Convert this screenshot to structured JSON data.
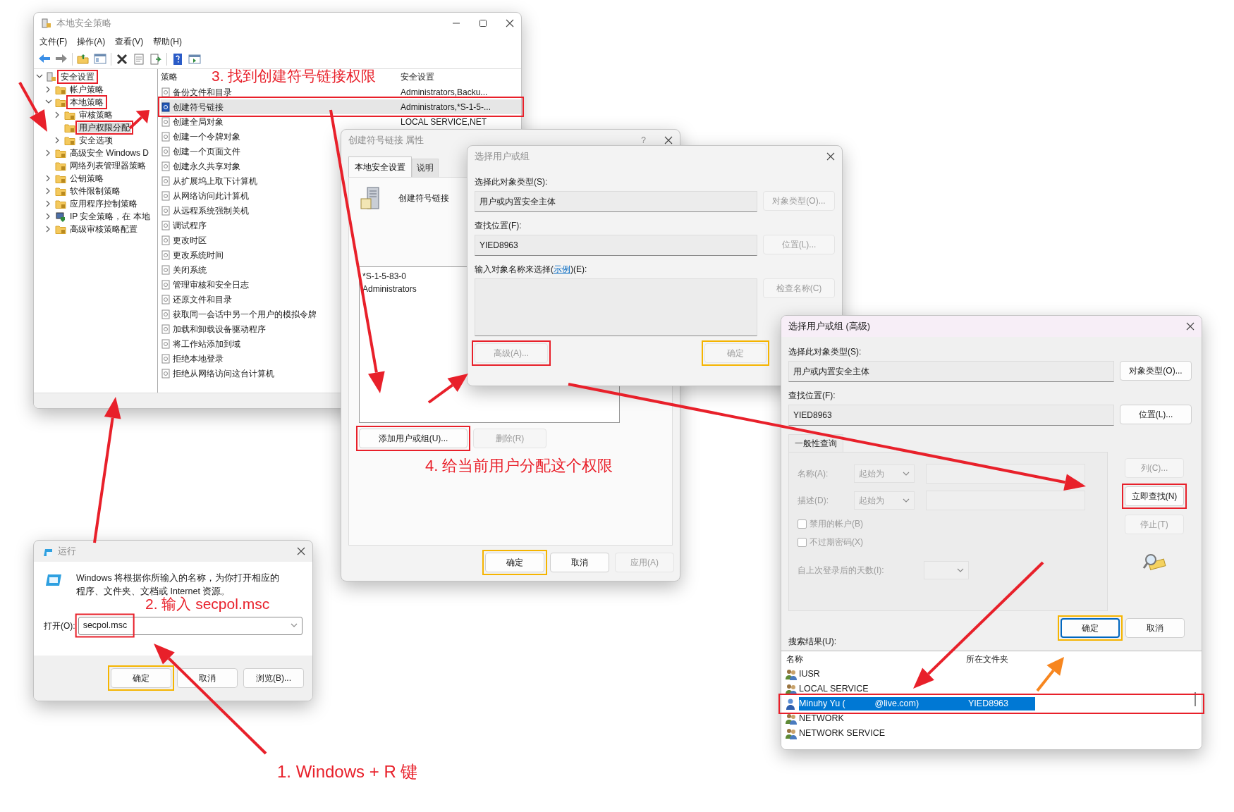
{
  "main_window": {
    "title": "本地安全策略",
    "active": false,
    "menu": [
      "文件(F)",
      "操作(A)",
      "查看(V)",
      "帮助(H)"
    ],
    "tree": [
      {
        "label": "安全设置",
        "kind": "security",
        "expandable": true,
        "expanded": true,
        "selected": false,
        "children": [
          {
            "label": "帐户策略",
            "kind": "folder",
            "expandable": true,
            "expanded": false,
            "selected": false
          },
          {
            "label": "本地策略",
            "kind": "folder",
            "expandable": true,
            "expanded": true,
            "selected": false,
            "children": [
              {
                "label": "审核策略",
                "kind": "folder",
                "expandable": true,
                "expanded": false,
                "selected": false
              },
              {
                "label": "用户权限分配",
                "kind": "folder",
                "expandable": false,
                "selected": true
              },
              {
                "label": "安全选项",
                "kind": "folder",
                "expandable": true,
                "expanded": false,
                "selected": false
              }
            ]
          },
          {
            "label": "高级安全 Windows D",
            "kind": "folder",
            "expandable": true,
            "expanded": false,
            "selected": false
          },
          {
            "label": "网络列表管理器策略",
            "kind": "folder",
            "expandable": false,
            "selected": false
          },
          {
            "label": "公钥策略",
            "kind": "folder",
            "expandable": true,
            "expanded": false,
            "selected": false
          },
          {
            "label": "软件限制策略",
            "kind": "folder",
            "expandable": true,
            "expanded": false,
            "selected": false
          },
          {
            "label": "应用程序控制策略",
            "kind": "folder",
            "expandable": true,
            "expanded": false,
            "selected": false
          },
          {
            "label": "IP 安全策略，在 本地",
            "kind": "ip",
            "expandable": true,
            "expanded": false,
            "selected": false
          },
          {
            "label": "高级审核策略配置",
            "kind": "folder",
            "expandable": true,
            "expanded": false,
            "selected": false
          }
        ]
      }
    ],
    "columns": [
      "策略",
      "安全设置"
    ],
    "rows": [
      {
        "policy": "备份文件和目录",
        "setting": "Administrators,Backu...",
        "selected": false
      },
      {
        "policy": "创建符号链接",
        "setting": "Administrators,*S-1-5-...",
        "selected": true
      },
      {
        "policy": "创建全局对象",
        "setting": "LOCAL SERVICE,NET",
        "selected": false
      },
      {
        "policy": "创建一个令牌对象",
        "selected": false
      },
      {
        "policy": "创建一个页面文件",
        "selected": false
      },
      {
        "policy": "创建永久共享对象",
        "selected": false
      },
      {
        "policy": "从扩展坞上取下计算机",
        "selected": false
      },
      {
        "policy": "从网络访问此计算机",
        "selected": false
      },
      {
        "policy": "从远程系统强制关机",
        "selected": false
      },
      {
        "policy": "调试程序",
        "selected": false
      },
      {
        "policy": "更改时区",
        "selected": false
      },
      {
        "policy": "更改系统时间",
        "selected": false
      },
      {
        "policy": "关闭系统",
        "selected": false
      },
      {
        "policy": "管理审核和安全日志",
        "selected": false
      },
      {
        "policy": "还原文件和目录",
        "selected": false
      },
      {
        "policy": "获取同一会话中另一个用户的模拟令牌",
        "selected": false
      },
      {
        "policy": "加载和卸载设备驱动程序",
        "selected": false
      },
      {
        "policy": "将工作站添加到域",
        "selected": false
      },
      {
        "policy": "拒绝本地登录",
        "selected": false
      },
      {
        "policy": "拒绝从网络访问这台计算机",
        "selected": false
      }
    ]
  },
  "properties_dialog": {
    "title": "创建符号链接 属性",
    "active": false,
    "help": "?",
    "tabs": [
      {
        "label": "本地安全设置",
        "selected": true
      },
      {
        "label": "说明",
        "selected": false
      }
    ],
    "policy_name": "创建符号链接",
    "members": [
      "*S-1-5-83-0",
      "Administrators"
    ],
    "buttons": [
      {
        "label": "添加用户或组(U)...",
        "disabled": false
      },
      {
        "label": "删除(R)",
        "disabled": true
      }
    ],
    "footer_buttons": [
      {
        "label": "确定",
        "disabled": false
      },
      {
        "label": "取消",
        "disabled": false
      },
      {
        "label": "应用(A)",
        "disabled": true
      }
    ]
  },
  "select_dialog": {
    "title": "选择用户或组",
    "active": false,
    "object_type_label": "选择此对象类型(S):",
    "object_type": "用户或内置安全主体",
    "object_type_button": {
      "label": "对象类型(O)...",
      "disabled": true
    },
    "location_label": "查找位置(F):",
    "location": "YIED8963",
    "location_button": {
      "label": "位置(L)...",
      "disabled": true
    },
    "names_label": {
      "before": "输入对象名称来选择(",
      "link": "示例",
      "after": ")(E):"
    },
    "check_button": {
      "label": "检查名称(C)",
      "disabled": true
    },
    "advanced_button": {
      "label": "高级(A)...",
      "disabled": true
    },
    "ok_button": {
      "label": "确定",
      "disabled": true
    }
  },
  "advanced_dialog": {
    "title": "选择用户或组 (高级)",
    "active": true,
    "object_type_label": "选择此对象类型(S):",
    "object_type": "用户或内置安全主体",
    "object_type_button": {
      "label": "对象类型(O)...",
      "disabled": false
    },
    "location_label": "查找位置(F):",
    "location": "YIED8963",
    "location_button": {
      "label": "位置(L)...",
      "disabled": false
    },
    "query": {
      "tab": "一般性查询",
      "disabled": true,
      "name_label": "名称(A):",
      "name_mode": "起始为",
      "description_label": "描述(D):",
      "description_mode": "起始为",
      "checkboxes": [
        {
          "label": "禁用的帐户(B)",
          "checked": false
        },
        {
          "label": "不过期密码(X)",
          "checked": false
        }
      ],
      "days_label": "自上次登录后的天数(I):"
    },
    "side_buttons": [
      {
        "label": "列(C)...",
        "disabled": true
      },
      {
        "label": "立即查找(N)",
        "disabled": false
      },
      {
        "label": "停止(T)",
        "disabled": true
      }
    ],
    "ok_button": {
      "label": "确定",
      "disabled": false,
      "default": true
    },
    "cancel_button": {
      "label": "取消",
      "disabled": false,
      "default": false
    },
    "results_label": "搜索结果(U):",
    "result_columns": [
      "名称",
      "所在文件夹"
    ],
    "results": [
      {
        "name": "IUSR",
        "kind": "group",
        "selected": false
      },
      {
        "name": "LOCAL SERVICE",
        "kind": "group",
        "selected": false
      },
      {
        "name": "Minuhy Yu (            @live.com)",
        "folder": "YIED8963",
        "kind": "user",
        "selected": true
      },
      {
        "name": "NETWORK",
        "kind": "group",
        "selected": false
      },
      {
        "name": "NETWORK SERVICE",
        "kind": "group",
        "selected": false
      }
    ]
  },
  "run_dialog": {
    "title": "运行",
    "active": false,
    "description": "Windows 将根据你所输入的名称，为你打开相应的程序、文件夹、文档或 Internet 资源。",
    "open_label": "打开(O):",
    "command": "secpol.msc",
    "buttons": [
      {
        "label": "确定",
        "disabled": false
      },
      {
        "label": "取消",
        "disabled": false
      },
      {
        "label": "浏览(B)...",
        "disabled": false
      }
    ]
  },
  "annotations": [
    "3. 找到创建符号链接权限",
    "4. 给当前用户分配这个权限",
    "2. 输入 secpol.msc",
    "1. Windows + R 键"
  ]
}
